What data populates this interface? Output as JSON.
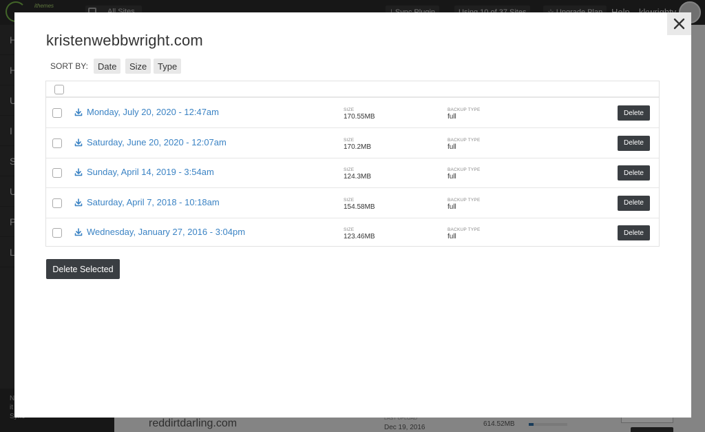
{
  "app": {
    "brand_small": "ithemes",
    "brand_big": "sync",
    "all_sites_label": "All Sites",
    "sync_plugin_label": "⤓ Sync Plugin",
    "usage_label": "Using 10 of 37 Sites",
    "upgrade_label": "☆ Upgrade Plan",
    "help_label": "Help",
    "user_name": "kkwrighty",
    "sidebar_items": [
      "H",
      "H",
      "U",
      "I",
      "S",
      "U",
      "P",
      "L"
    ],
    "sidebar_footer": "N\nit\nSync"
  },
  "background_row": {
    "site_name": "reddirtdarling.com",
    "last_upload_label": "LAST UPLOAD",
    "last_upload_value": "Dec 19, 2016",
    "size_value": "614.52MB",
    "progress_fraction": 0.12
  },
  "modal": {
    "title": "kristenwebbwright.com",
    "sort_label": "SORT BY:",
    "sort_options": [
      "Date",
      "Size",
      "Type"
    ],
    "size_label": "SIZE",
    "type_label": "BACKUP TYPE",
    "delete_label": "Delete",
    "delete_selected_label": "Delete Selected",
    "backups": [
      {
        "date": "Monday, July 20, 2020 - 12:47am",
        "size": "170.55MB",
        "type": "full"
      },
      {
        "date": "Saturday, June 20, 2020 - 12:07am",
        "size": "170.2MB",
        "type": "full"
      },
      {
        "date": "Sunday, April 14, 2019 - 3:54am",
        "size": "124.3MB",
        "type": "full"
      },
      {
        "date": "Saturday, April 7, 2018 - 10:18am",
        "size": "154.58MB",
        "type": "full"
      },
      {
        "date": "Wednesday, January 27, 2016 - 3:04pm",
        "size": "123.46MB",
        "type": "full"
      }
    ]
  },
  "colors": {
    "link": "#3b83c4",
    "dark_button": "#3a3e42",
    "brand_green": "#79b94a"
  },
  "icons": {
    "close": "close-icon",
    "download": "download-icon"
  }
}
